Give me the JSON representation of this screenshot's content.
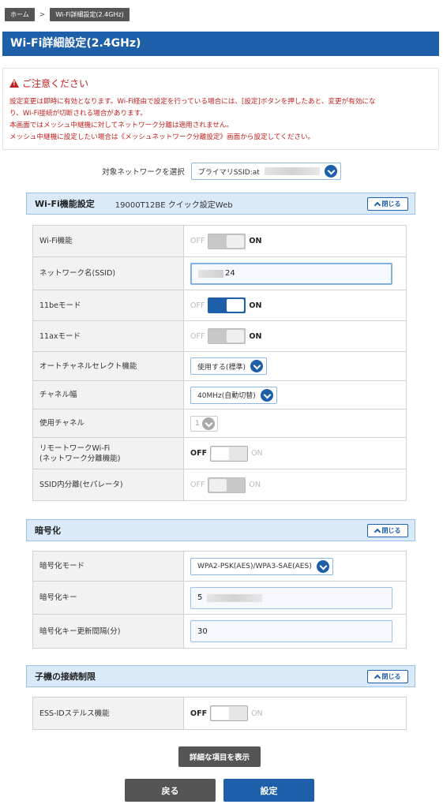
{
  "breadcrumb": {
    "home": "ホーム",
    "separator": ">",
    "current": "Wi-Fi詳細設定(2.4GHz)"
  },
  "page_title": "Wi-Fi詳細設定(2.4GHz)",
  "notice": {
    "title": "ご注意ください",
    "lines": [
      "設定変更は即時に有効となります。Wi-Fi経由で設定を行っている場合には、[設定]ボタンを押したあと、変更が有効にな",
      "り、Wi-Fi接続が切断される場合があります。",
      "本画面ではメッシュ中継機に対してネットワーク分離は適用されません。",
      "メッシュ中継機に設定したい場合は《メッシュネットワーク分離設定》画面から設定してください。"
    ]
  },
  "network_select": {
    "label": "対象ネットワークを選択",
    "value": "プライマリSSID:at"
  },
  "wifi_section": {
    "title": "Wi-Fi機能設定",
    "subtitle": "19000T12BE クイック設定Web",
    "close_label": "閉じる",
    "rows": {
      "wifi": {
        "label": "Wi-Fi機能",
        "off": "OFF",
        "on": "ON",
        "state": "on"
      },
      "ssid": {
        "label": "ネットワーク名(SSID)",
        "value": "24"
      },
      "be": {
        "label": "11beモード",
        "off": "OFF",
        "on": "ON",
        "state": "on"
      },
      "ax": {
        "label": "11axモード",
        "off": "OFF",
        "on": "ON",
        "state": "on"
      },
      "auto_channel": {
        "label": "オートチャネルセレクト機能",
        "value": "使用する(標準)"
      },
      "bandwidth": {
        "label": "チャネル幅",
        "value": "40MHz(自動切替)"
      },
      "channel": {
        "label": "使用チャネル",
        "value": "1"
      },
      "remote": {
        "label_line1": "リモートワークWi-Fi",
        "label_line2": "(ネットワーク分離機能)",
        "off": "OFF",
        "on": "ON",
        "state": "off"
      },
      "separator": {
        "label": "SSID内分離(セパレータ)",
        "off": "OFF",
        "on": "ON",
        "state": "off"
      }
    }
  },
  "encryption_section": {
    "title": "暗号化",
    "close_label": "閉じる",
    "rows": {
      "mode": {
        "label": "暗号化モード",
        "value": "WPA2-PSK(AES)/WPA3-SAE(AES)"
      },
      "key": {
        "label": "暗号化キー",
        "value": "5"
      },
      "interval": {
        "label": "暗号化キー更新間隔(分)",
        "value": "30"
      }
    }
  },
  "client_section": {
    "title": "子機の接続制限",
    "close_label": "閉じる",
    "rows": {
      "stealth": {
        "label": "ESS-IDステルス機能",
        "off": "OFF",
        "on": "ON",
        "state": "off"
      }
    }
  },
  "buttons": {
    "detail": "詳細な項目を表示",
    "back": "戻る",
    "apply": "設定"
  },
  "colors": {
    "brand": "#1d5fa8",
    "warning": "#c02020",
    "section_bg": "#dbeaf9"
  }
}
